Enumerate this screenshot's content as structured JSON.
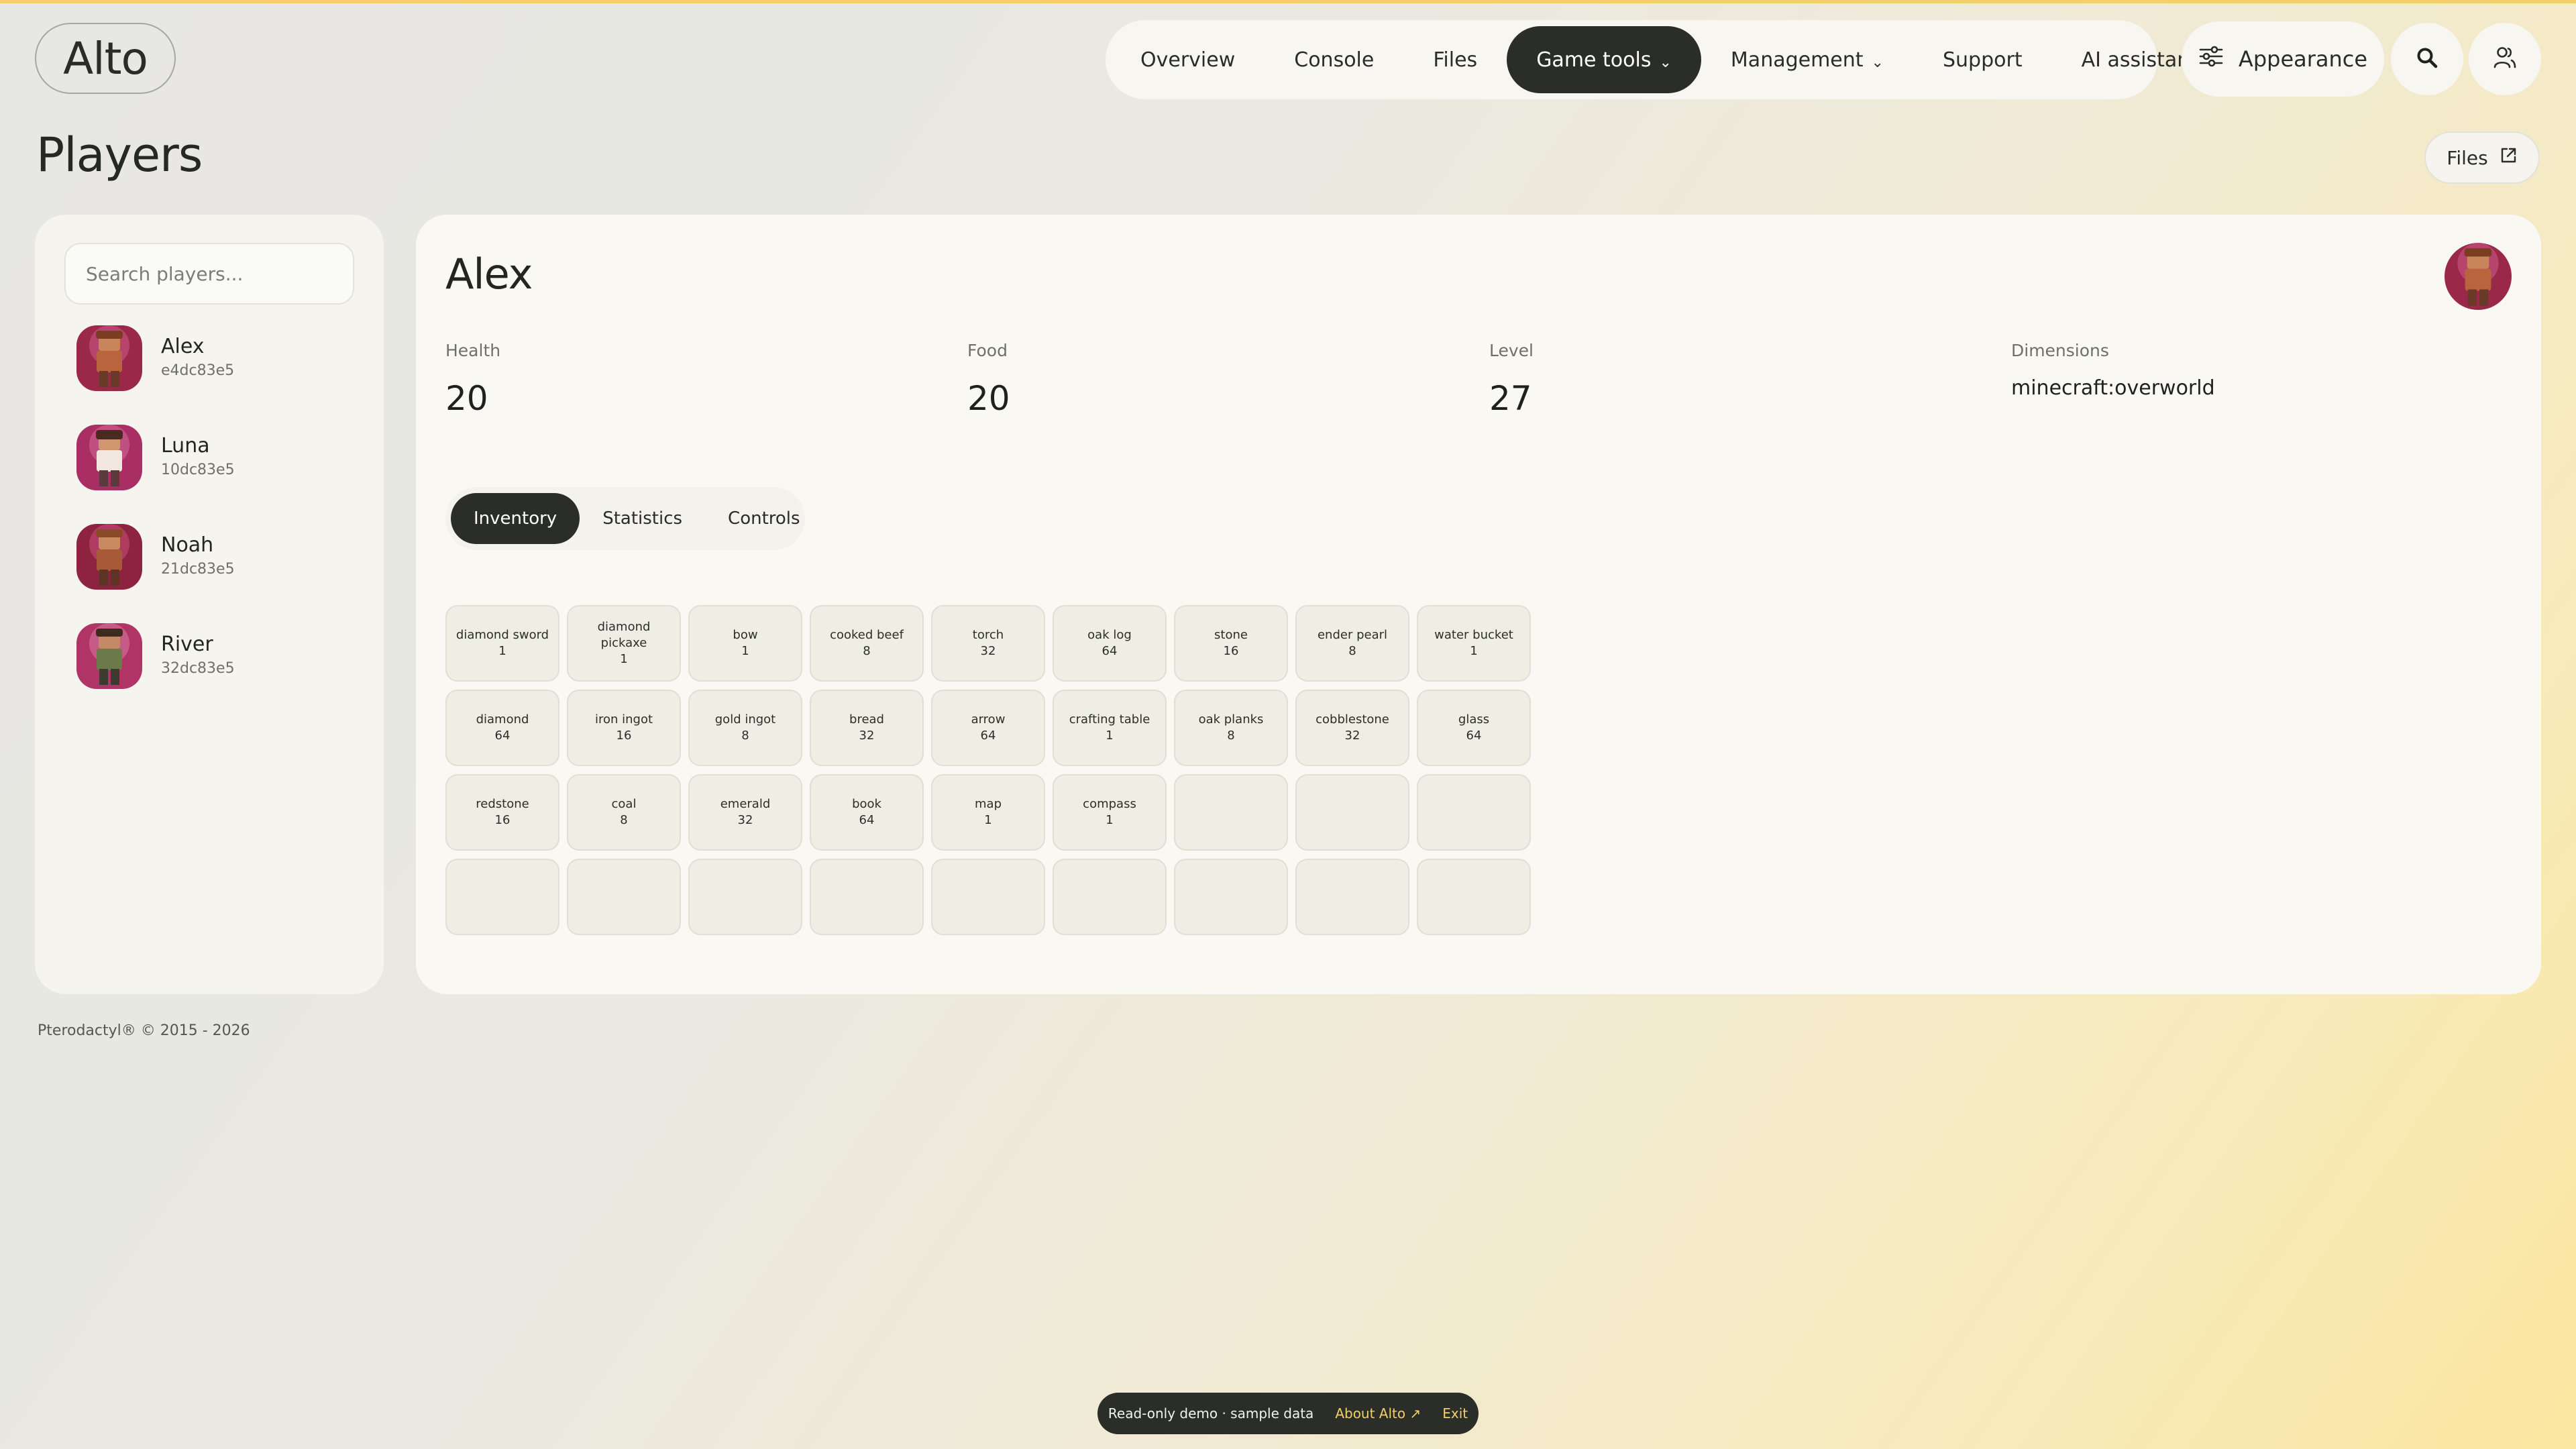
{
  "app": {
    "logo": "Alto"
  },
  "nav": {
    "items": [
      {
        "label": "Overview"
      },
      {
        "label": "Console"
      },
      {
        "label": "Files"
      },
      {
        "label": "Game tools",
        "dropdown": true,
        "active": true
      },
      {
        "label": "Management",
        "dropdown": true
      },
      {
        "label": "Support"
      },
      {
        "label": "AI assistant"
      }
    ],
    "appearance_label": "Appearance"
  },
  "page": {
    "title": "Players",
    "files_button": "Files"
  },
  "sidebar": {
    "search_placeholder": "Search players...",
    "players": [
      {
        "name": "Alex",
        "id": "e4dc83e5"
      },
      {
        "name": "Luna",
        "id": "10dc83e5"
      },
      {
        "name": "Noah",
        "id": "21dc83e5"
      },
      {
        "name": "River",
        "id": "32dc83e5"
      }
    ]
  },
  "player": {
    "name": "Alex",
    "stats": {
      "health_label": "Health",
      "health": "20",
      "food_label": "Food",
      "food": "20",
      "level_label": "Level",
      "level": "27",
      "dimensions_label": "Dimensions",
      "dimensions": "minecraft:overworld"
    },
    "tabs": [
      {
        "label": "Inventory",
        "active": true
      },
      {
        "label": "Statistics"
      },
      {
        "label": "Controls"
      }
    ],
    "inventory": [
      {
        "name": "diamond sword",
        "count": "1"
      },
      {
        "name": "diamond pickaxe",
        "count": "1"
      },
      {
        "name": "bow",
        "count": "1"
      },
      {
        "name": "cooked beef",
        "count": "8"
      },
      {
        "name": "torch",
        "count": "32"
      },
      {
        "name": "oak log",
        "count": "64"
      },
      {
        "name": "stone",
        "count": "16"
      },
      {
        "name": "ender pearl",
        "count": "8"
      },
      {
        "name": "water bucket",
        "count": "1"
      },
      {
        "name": "diamond",
        "count": "64"
      },
      {
        "name": "iron ingot",
        "count": "16"
      },
      {
        "name": "gold ingot",
        "count": "8"
      },
      {
        "name": "bread",
        "count": "32"
      },
      {
        "name": "arrow",
        "count": "64"
      },
      {
        "name": "crafting table",
        "count": "1"
      },
      {
        "name": "oak planks",
        "count": "8"
      },
      {
        "name": "cobblestone",
        "count": "32"
      },
      {
        "name": "glass",
        "count": "64"
      },
      {
        "name": "redstone",
        "count": "16"
      },
      {
        "name": "coal",
        "count": "8"
      },
      {
        "name": "emerald",
        "count": "32"
      },
      {
        "name": "book",
        "count": "64"
      },
      {
        "name": "map",
        "count": "1"
      },
      {
        "name": "compass",
        "count": "1"
      },
      null,
      null,
      null,
      null,
      null,
      null,
      null,
      null,
      null,
      null,
      null,
      null
    ]
  },
  "footer": {
    "text": "Pterodactyl® © 2015 - 2026"
  },
  "demo_bar": {
    "text": "Read-only demo · sample data",
    "about_label": "About Alto ↗",
    "exit_label": "Exit"
  },
  "colors": {
    "accent": "#f2cf6a",
    "dark": "#2b2d28",
    "panel": "#f9f8f3"
  }
}
